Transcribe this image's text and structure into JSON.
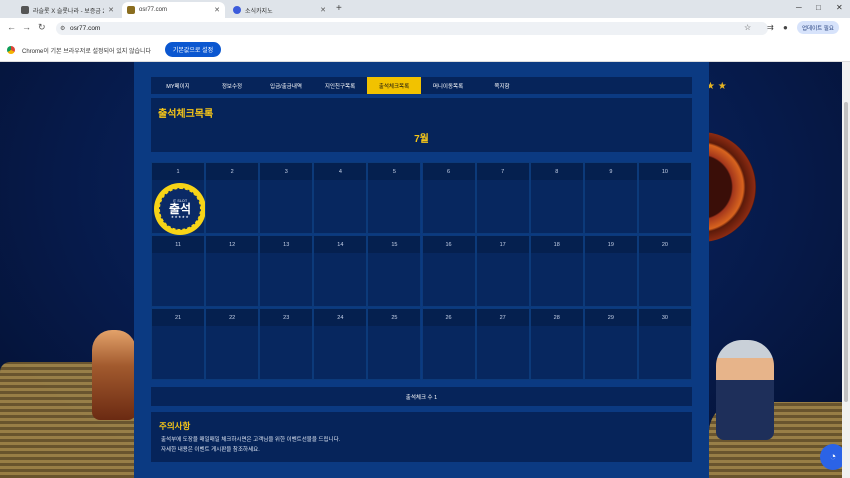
{
  "browser": {
    "tabs": [
      {
        "title": "라슬롯 X 슬롯나라 - 보증금 2억",
        "favicon_color": "#555555"
      },
      {
        "title": "osr77.com",
        "favicon_color": "#8a6d1f"
      },
      {
        "title": "소식카지노",
        "favicon_color": "#3b5bdb"
      }
    ],
    "new_tab": "+",
    "window_controls": {
      "minimize": "─",
      "maximize": "□",
      "close": "✕"
    },
    "url": "osr77.com",
    "update_button": "업데이트 필요",
    "infobar_message": "Chrome이 기본 브라우저로 설정되어 있지 않습니다",
    "infobar_button": "기본값으로 설정"
  },
  "menu": [
    {
      "label": "MY페이지",
      "active": false
    },
    {
      "label": "정보수정",
      "active": false
    },
    {
      "label": "입금/출금내역",
      "active": false
    },
    {
      "label": "지인친구목록",
      "active": false
    },
    {
      "label": "출석체크목록",
      "active": true
    },
    {
      "label": "머니이동목록",
      "active": false
    },
    {
      "label": "쪽지함",
      "active": false
    }
  ],
  "attendance": {
    "title": "출석체크목록",
    "month": "7월",
    "stamp": {
      "brand": "IT SLOT",
      "word": "출석",
      "stars": "★★★★★",
      "day": 1
    },
    "days": [
      1,
      2,
      3,
      4,
      5,
      6,
      7,
      8,
      9,
      10,
      11,
      12,
      13,
      14,
      15,
      16,
      17,
      18,
      19,
      20,
      21,
      22,
      23,
      24,
      25,
      26,
      27,
      28,
      29,
      30
    ],
    "count_text": "출석체크 수 1"
  },
  "notice": {
    "title": "주의사항",
    "line1": "출석부에 도장을 매일매일 체크하시면은 고객님을 위한 이벤트선물을 드립니다.",
    "line2": "자세한 내용은 이벤트 게시판을 참조하세요."
  },
  "colors": {
    "accent": "#f2c200",
    "panel": "#06245a",
    "container": "#0b3a82"
  }
}
